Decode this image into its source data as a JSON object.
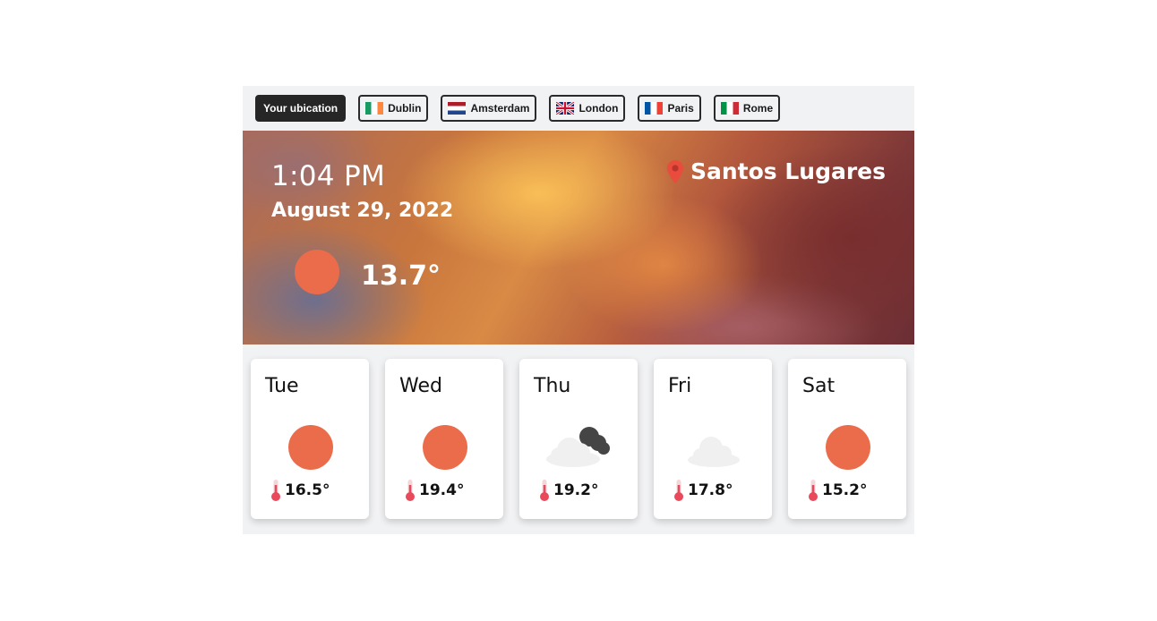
{
  "tabs": [
    {
      "label": "Your ubication",
      "flag": "",
      "active": true
    },
    {
      "label": "Dublin",
      "flag": "ireland-flag-icon",
      "active": false
    },
    {
      "label": "Amsterdam",
      "flag": "netherlands-flag-icon",
      "active": false
    },
    {
      "label": "London",
      "flag": "uk-flag-icon",
      "active": false
    },
    {
      "label": "Paris",
      "flag": "france-flag-icon",
      "active": false
    },
    {
      "label": "Rome",
      "flag": "italy-flag-icon",
      "active": false
    }
  ],
  "current": {
    "time": "1:04 PM",
    "date": "August 29, 2022",
    "location": "Santos Lugares",
    "temperature": "13.7°",
    "condition_icon": "sun-icon"
  },
  "forecast": [
    {
      "day": "Tue",
      "icon": "sun-icon",
      "temperature": "16.5°"
    },
    {
      "day": "Wed",
      "icon": "sun-icon",
      "temperature": "19.4°"
    },
    {
      "day": "Thu",
      "icon": "cloudy-night-icon",
      "temperature": "19.2°"
    },
    {
      "day": "Fri",
      "icon": "cloud-icon",
      "temperature": "17.8°"
    },
    {
      "day": "Sat",
      "icon": "sun-icon",
      "temperature": "15.2°"
    }
  ],
  "colors": {
    "accent": "#ea6c4a",
    "active_tab": "#262626",
    "panel_background": "#f1f2f4",
    "location_pin": "#e94b3c",
    "thermometer": "#e8495b"
  }
}
